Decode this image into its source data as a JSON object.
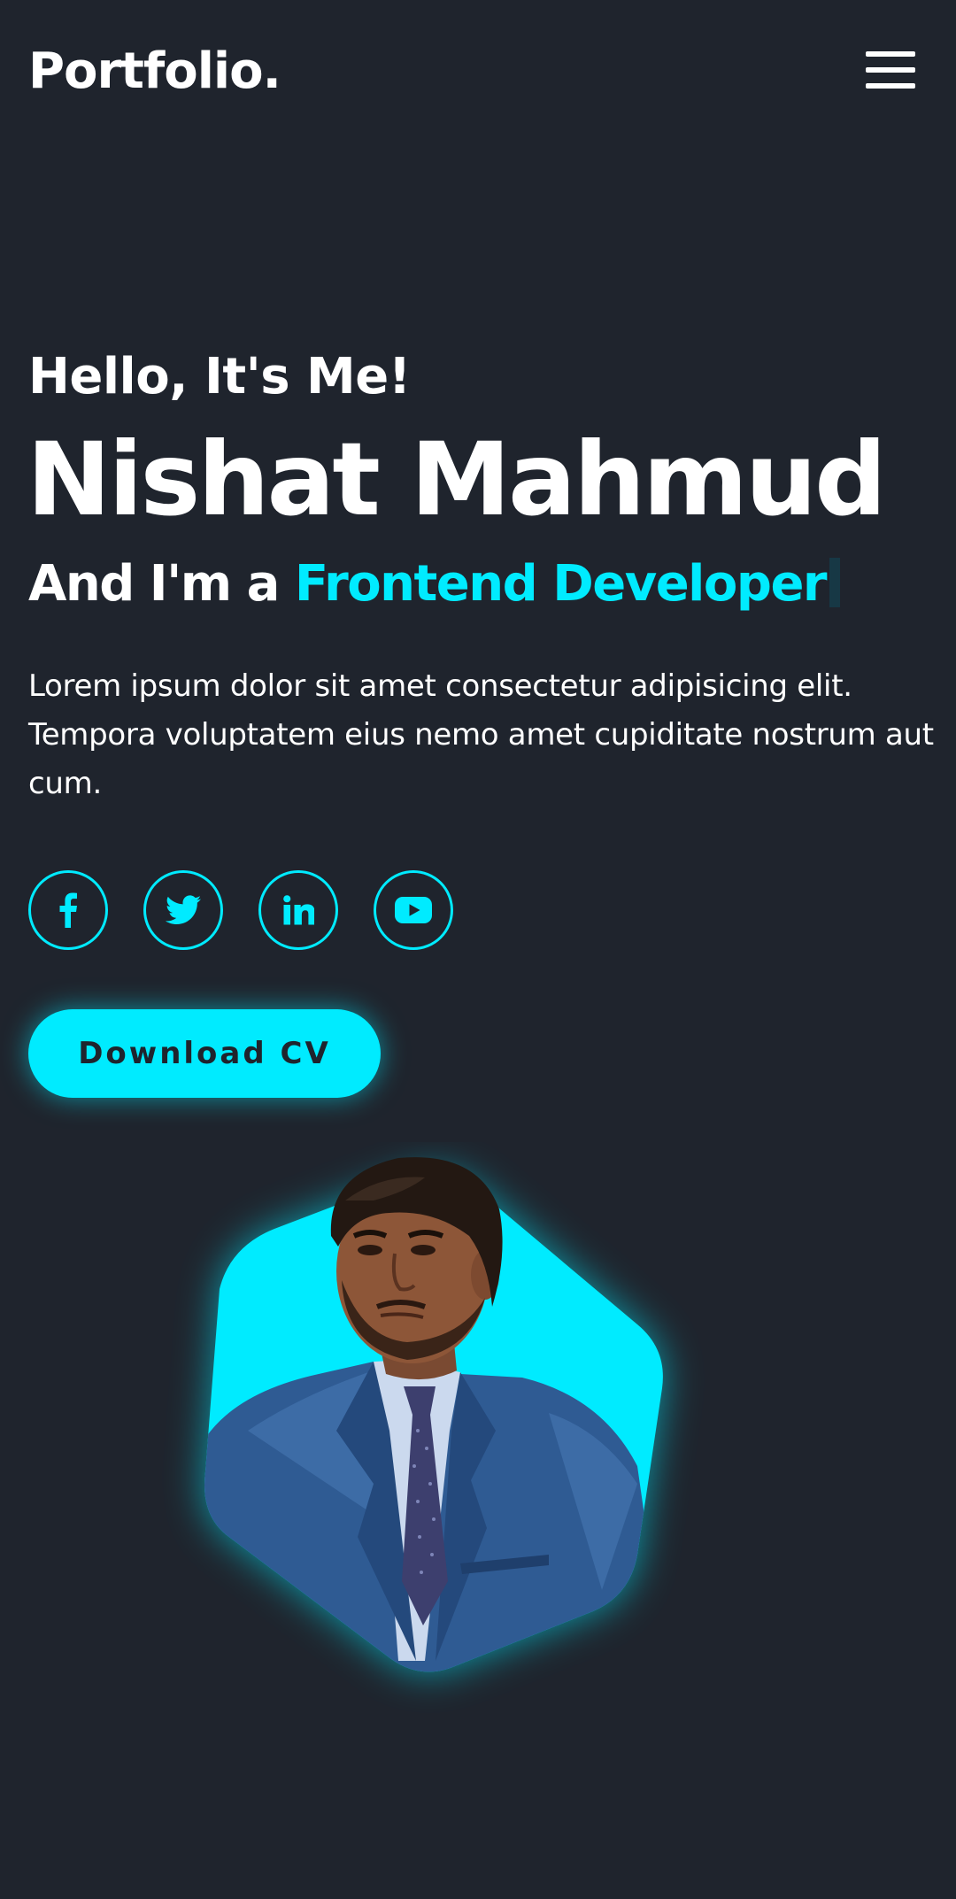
{
  "header": {
    "logo": "Portfolio.",
    "menu_icon": "hamburger-menu-icon"
  },
  "hero": {
    "greeting": "Hello, It's Me!",
    "name": "Nishat Mahmud",
    "role_prefix": "And I'm a",
    "role": "Frontend Developer",
    "description": "Lorem ipsum dolor sit amet consectetur adipisicing elit. Tempora voluptatem eius nemo amet cupiditate nostrum aut cum.",
    "social": [
      {
        "icon": "facebook-icon"
      },
      {
        "icon": "twitter-icon"
      },
      {
        "icon": "linkedin-icon"
      },
      {
        "icon": "youtube-icon"
      }
    ],
    "cta_label": "Download CV",
    "portrait_icon": "profile-photo"
  },
  "colors": {
    "background": "#1f242d",
    "accent": "#00ebff",
    "text": "#ffffff"
  }
}
